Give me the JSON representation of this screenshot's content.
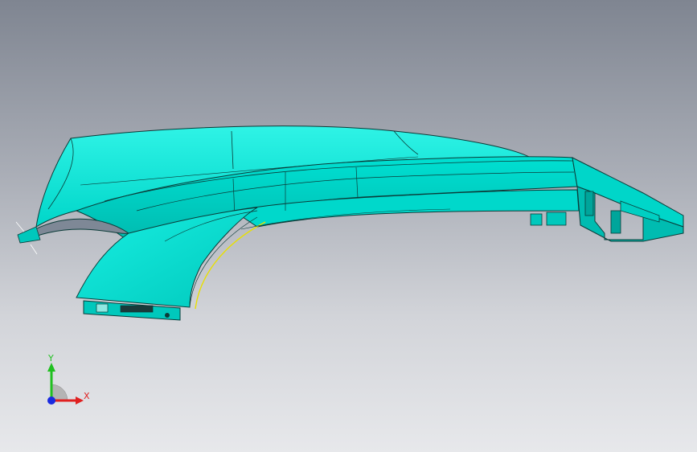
{
  "viewport": {
    "background_top": "#7f8591",
    "background_bottom": "#e7e8eb"
  },
  "model": {
    "face_color": "#00e5d6",
    "face_shade_color": "#00bfb3",
    "edge_color": "#0b3b38",
    "accent_edge_color": "#e8e000"
  },
  "triad": {
    "x_label": "X",
    "y_label": "Y",
    "x_color": "#e02020",
    "y_color": "#20c020",
    "z_color": "#1a2ae0"
  }
}
